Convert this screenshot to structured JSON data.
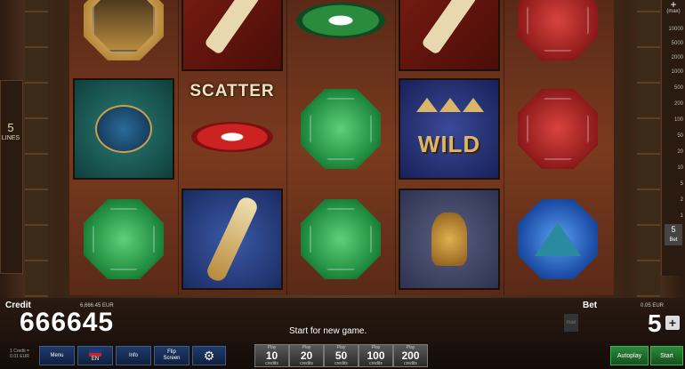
{
  "lines": {
    "count": "5",
    "label": "LINES"
  },
  "bet_scale": {
    "plus": "+",
    "max_label": "(max)",
    "items": [
      "10000",
      "5000",
      "2000",
      "1000",
      "500",
      "200",
      "100",
      "50",
      "20",
      "10",
      "5",
      "2",
      "1"
    ],
    "current_value": "5",
    "current_label": "Bet"
  },
  "reels": {
    "scatter_label": "SCATTER",
    "wild_label": "WILD"
  },
  "credit": {
    "label": "Credit",
    "eur": "6,666.45 EUR",
    "value": "666645",
    "rate_line1": "1 Credit =",
    "rate_line2": "0.01 EUR"
  },
  "status_message": "Start for new game.",
  "bet": {
    "label": "Bet",
    "eur": "0.05 EUR",
    "value": "5",
    "plus": "+",
    "max_btn": "max"
  },
  "buttons": {
    "menu": "Menu",
    "language": "EN",
    "info": "Info",
    "flip_screen_line1": "Flip",
    "flip_screen_line2": "Screen",
    "autoplay": "Autoplay",
    "start": "Start"
  },
  "play_buttons": [
    {
      "top": "Play",
      "value": "10",
      "bottom": "credits"
    },
    {
      "top": "Play",
      "value": "20",
      "bottom": "credits"
    },
    {
      "top": "Play",
      "value": "50",
      "bottom": "credits"
    },
    {
      "top": "Play",
      "value": "100",
      "bottom": "credits"
    },
    {
      "top": "Play",
      "value": "200",
      "bottom": "credits"
    }
  ],
  "colors": {
    "accent_green": "#2e8a3a",
    "button_blue": "#1f3a6a",
    "reel_red": "#7a3a1f"
  }
}
